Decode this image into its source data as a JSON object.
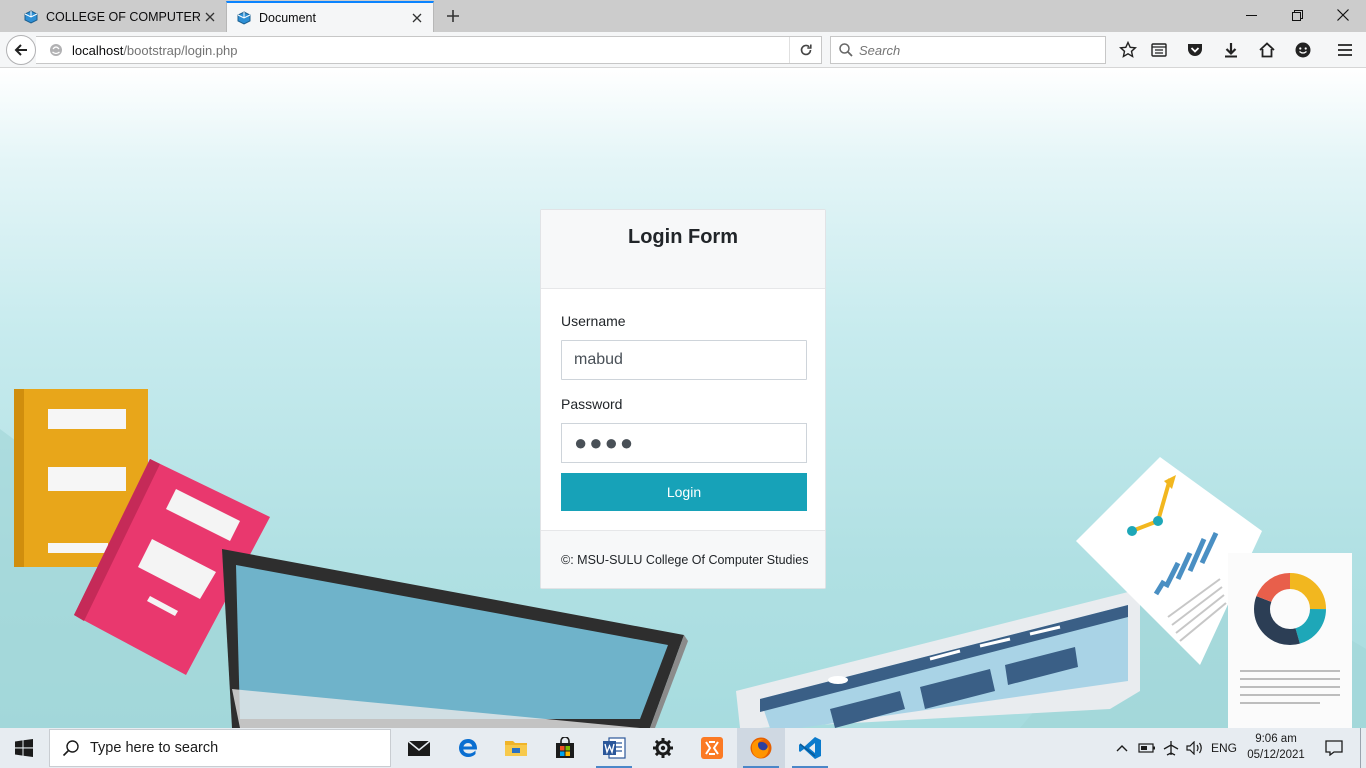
{
  "browser": {
    "tabs": [
      {
        "title": "COLLEGE OF COMPUTER ..."
      },
      {
        "title": "Document"
      }
    ],
    "url_host": "localhost",
    "url_path": "/bootstrap/login.php",
    "search_placeholder": "Search"
  },
  "login": {
    "title": "Login Form",
    "username_label": "Username",
    "username_value": "mabud",
    "password_label": "Password",
    "password_mask": "●●●●",
    "button_label": "Login",
    "footer": "©: MSU-SULU College Of Computer Studies"
  },
  "taskbar": {
    "search_placeholder": "Type here to search",
    "language": "ENG",
    "time": "9:06 am",
    "date": "05/12/2021"
  },
  "colors": {
    "accent_button": "#17a2b8",
    "tab_active_indicator": "#0a84ff"
  }
}
